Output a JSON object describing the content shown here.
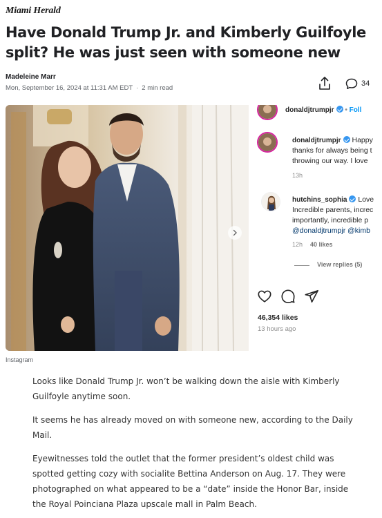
{
  "publication": {
    "name": "Miami Herald"
  },
  "article": {
    "headline": "Have Donald Trump Jr. and Kimberly Guilfoyle split? He was just seen with someone new",
    "author": "Madeleine Marr",
    "date": "Mon, September 16, 2024 at 11:31 AM EDT",
    "read_time": "2 min read",
    "comment_count": "34"
  },
  "embed": {
    "source": "Instagram",
    "header": {
      "username": "donaldjtrumpjr",
      "follow_label": "Foll"
    },
    "comments": [
      {
        "username": "donaldjtrumpjr",
        "lines": [
          "Happy",
          "thanks for always being t",
          "throwing our way. I love"
        ],
        "time": "13h"
      },
      {
        "username": "hutchins_sophia",
        "lines": [
          "Love",
          "Incredible parents, increc",
          "importantly, incredible p",
          "@donaldjtrumpjr @kimb"
        ],
        "time": "12h",
        "likes": "40 likes",
        "view_replies": "View replies (5)"
      }
    ],
    "likes": "46,354 likes",
    "posted": "13 hours ago"
  },
  "icons": {
    "share": "share-icon",
    "comment": "comment-bubble-icon",
    "heart": "heart-icon",
    "ig_comment": "comment-icon",
    "send": "send-icon",
    "verified": "verified-badge-icon",
    "next": "chevron-right-icon"
  },
  "colors": {
    "instagram_blue": "#0095f6",
    "verified_blue": "#3797f0",
    "story_ring": "#d6249f"
  },
  "paragraphs": [
    "Looks like Donald Trump Jr. won’t be walking down the aisle with Kimberly Guilfoyle anytime soon.",
    "It seems he has already moved on with someone new, according to the Daily Mail.",
    "Eyewitnesses told the outlet that the former president’s oldest child was spotted getting cozy with socialite Bettina Anderson on Aug. 17. They were photographed on what appeared to be a “date” inside the Honor Bar, inside the Royal Poinciana Plaza upscale mall in Palm Beach."
  ]
}
